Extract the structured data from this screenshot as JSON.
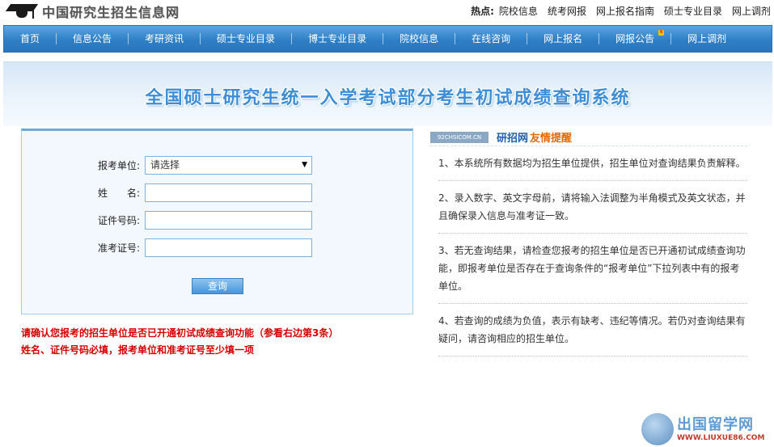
{
  "site": {
    "title": "中国研究生招生信息网"
  },
  "hot": {
    "label": "热点:",
    "links": [
      "院校信息",
      "统考网报",
      "网上报名指南",
      "硕士专业目录",
      "网上调剂"
    ]
  },
  "nav": {
    "items": [
      "首页",
      "信息公告",
      "考研资讯",
      "硕士专业目录",
      "博士专业目录",
      "院校信息",
      "在线咨询",
      "网上报名",
      "网报公告",
      "网上调剂"
    ],
    "badge_text": "N"
  },
  "banner": {
    "title": "全国硕士研究生统一入学考试部分考生初试成绩查询系统"
  },
  "form": {
    "unit_label": "报考单位:",
    "unit_value": "请选择",
    "name_label": "姓　　名:",
    "name_value": "",
    "id_label": "证件号码:",
    "id_value": "",
    "exam_label": "准考证号:",
    "exam_value": "",
    "submit_label": "查询"
  },
  "notice": {
    "line1": "请确认您报考的招生单位是否已开通初试成绩查询功能（参看右边第3条）",
    "line2": "姓名、证件号码必填，报考单位和准考证号至少填一项"
  },
  "tips": {
    "stamp": "92CHSICOM.CN",
    "title1": "研招网",
    "title2": "友情提醒",
    "items": [
      "1、本系统所有数据均为招生单位提供，招生单位对查询结果负责解释。",
      "2、录入数字、英文字母前，请将输入法调整为半角模式及英文状态，并且确保录入信息与准考证一致。",
      "3、若无查询结果，请检查您报考的招生单位是否已开通初试成绩查询功能，即报考单位是否存在于查询条件的“报考单位”下拉列表中有的报考单位。",
      "4、若查询的成绩为负值，表示有缺考、违纪等情况。若仍对查询结果有疑问，请咨询相应的招生单位。"
    ]
  },
  "watermark": {
    "name": "出国留学网",
    "url": "WWW.LIUXUE86.COM"
  }
}
